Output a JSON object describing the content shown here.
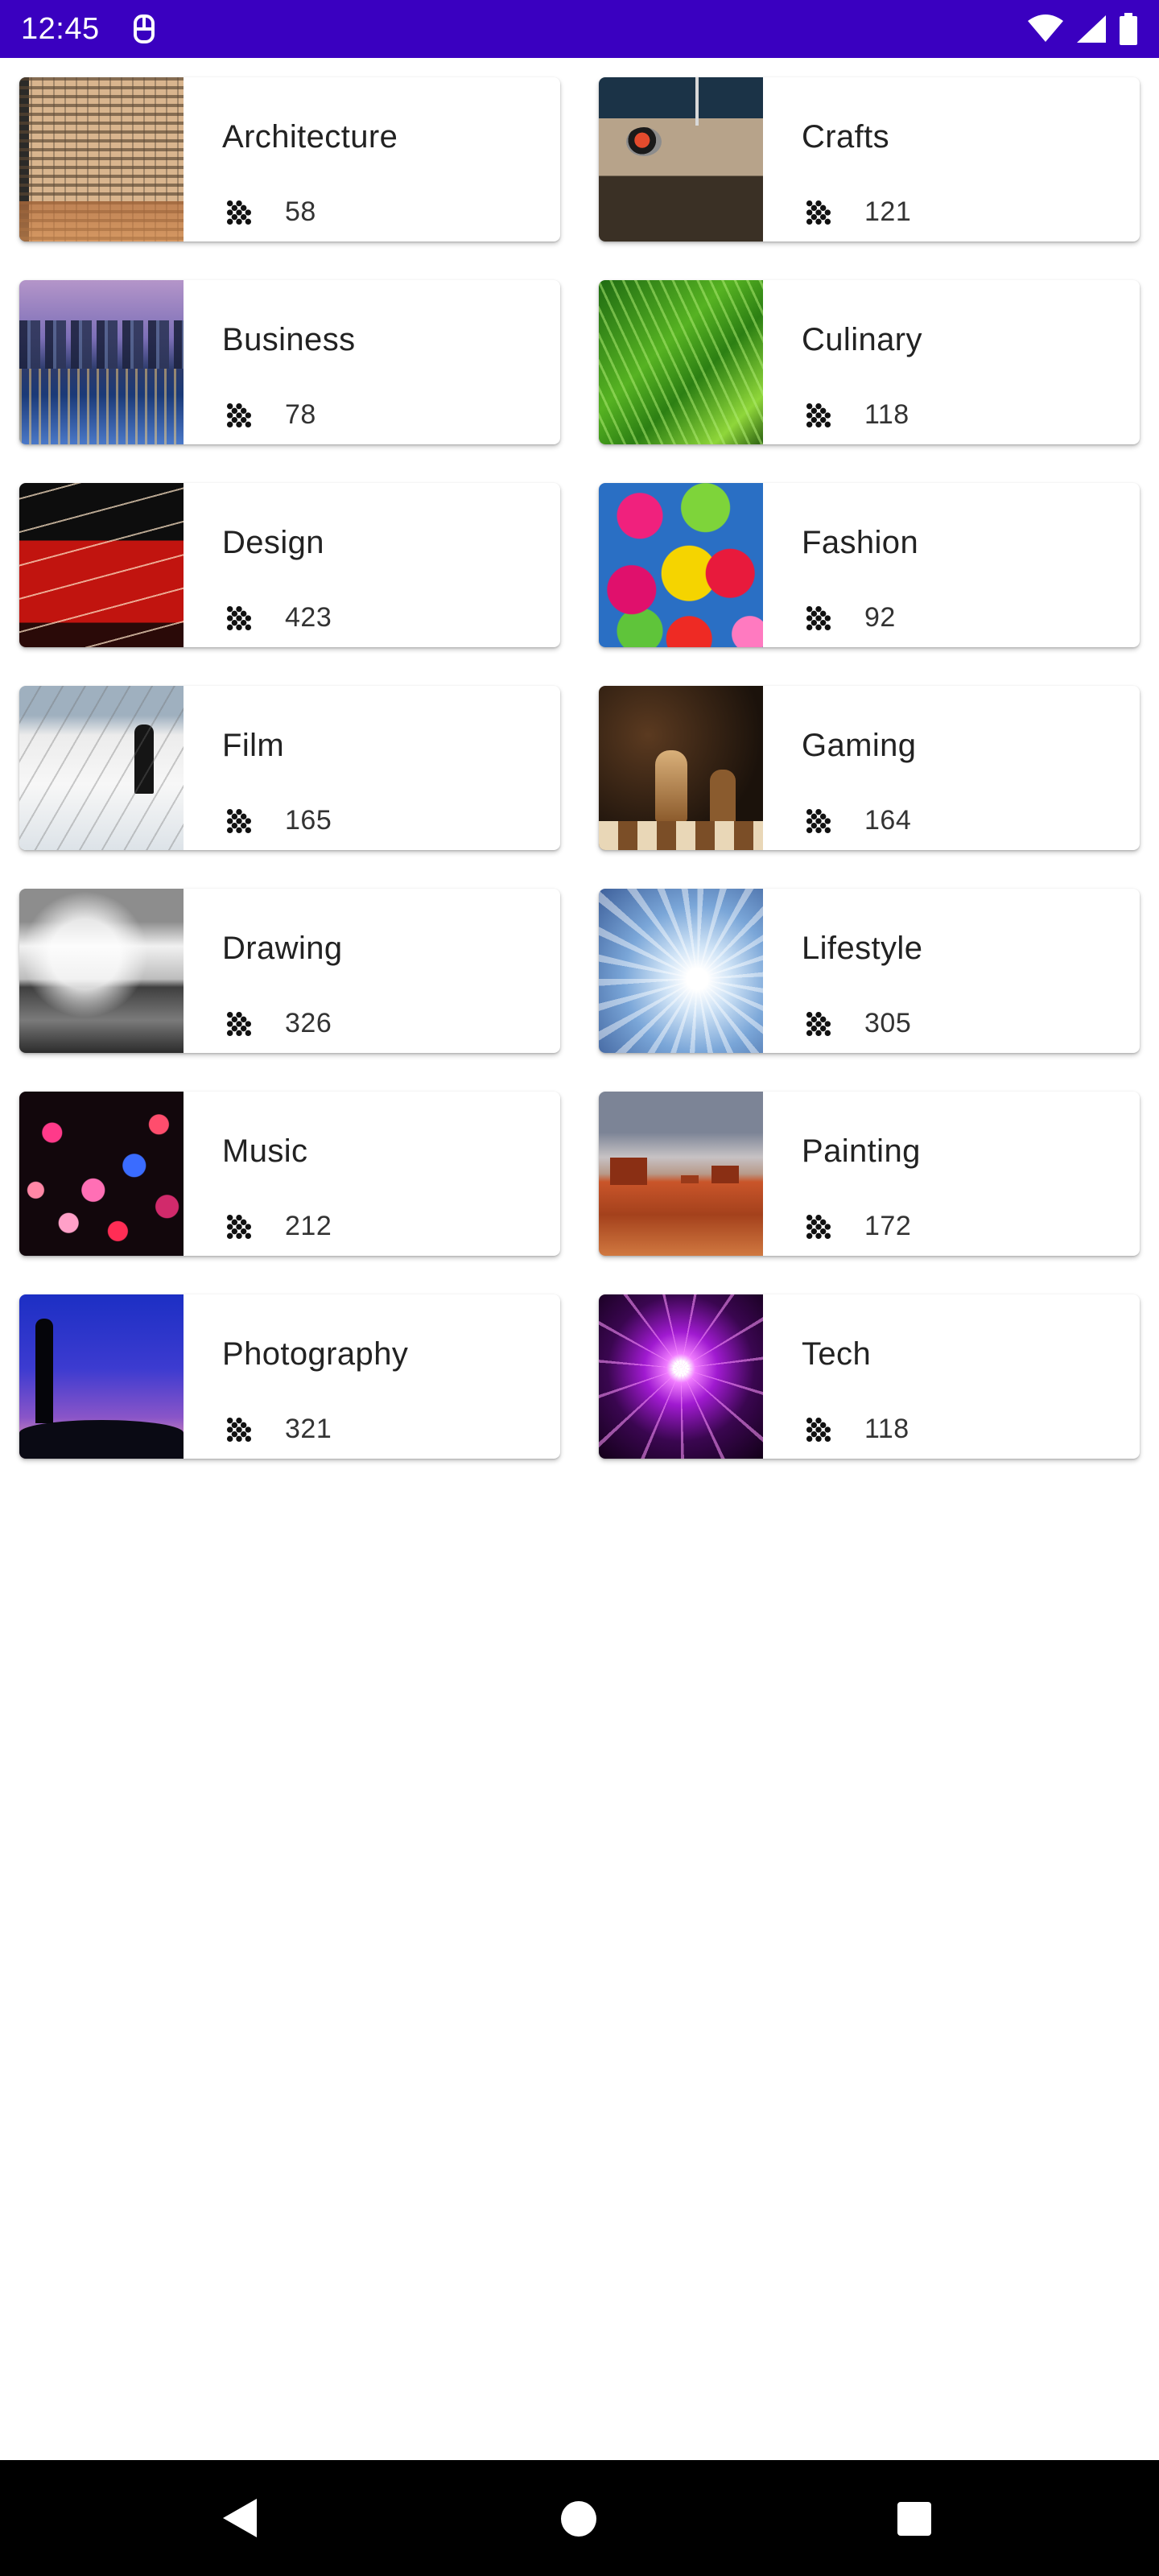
{
  "status_bar": {
    "time": "12:45",
    "background_color": "#3a00c0",
    "icons": [
      "notification-icon",
      "wifi-icon",
      "signal-icon",
      "battery-icon"
    ]
  },
  "categories": [
    {
      "name": "Architecture",
      "count": "58",
      "image": "architecture-thumbnail"
    },
    {
      "name": "Crafts",
      "count": "121",
      "image": "crafts-thumbnail"
    },
    {
      "name": "Business",
      "count": "78",
      "image": "business-thumbnail"
    },
    {
      "name": "Culinary",
      "count": "118",
      "image": "culinary-thumbnail"
    },
    {
      "name": "Design",
      "count": "423",
      "image": "design-thumbnail"
    },
    {
      "name": "Fashion",
      "count": "92",
      "image": "fashion-thumbnail"
    },
    {
      "name": "Film",
      "count": "165",
      "image": "film-thumbnail"
    },
    {
      "name": "Gaming",
      "count": "164",
      "image": "gaming-thumbnail"
    },
    {
      "name": "Drawing",
      "count": "326",
      "image": "drawing-thumbnail"
    },
    {
      "name": "Lifestyle",
      "count": "305",
      "image": "lifestyle-thumbnail"
    },
    {
      "name": "Music",
      "count": "212",
      "image": "music-thumbnail"
    },
    {
      "name": "Painting",
      "count": "172",
      "image": "painting-thumbnail"
    },
    {
      "name": "Photography",
      "count": "321",
      "image": "photography-thumbnail"
    },
    {
      "name": "Tech",
      "count": "118",
      "image": "tech-thumbnail"
    }
  ],
  "count_icon": "grain-dots-icon",
  "nav_bar": {
    "buttons": [
      "back-icon",
      "home-icon",
      "recents-icon"
    ]
  }
}
